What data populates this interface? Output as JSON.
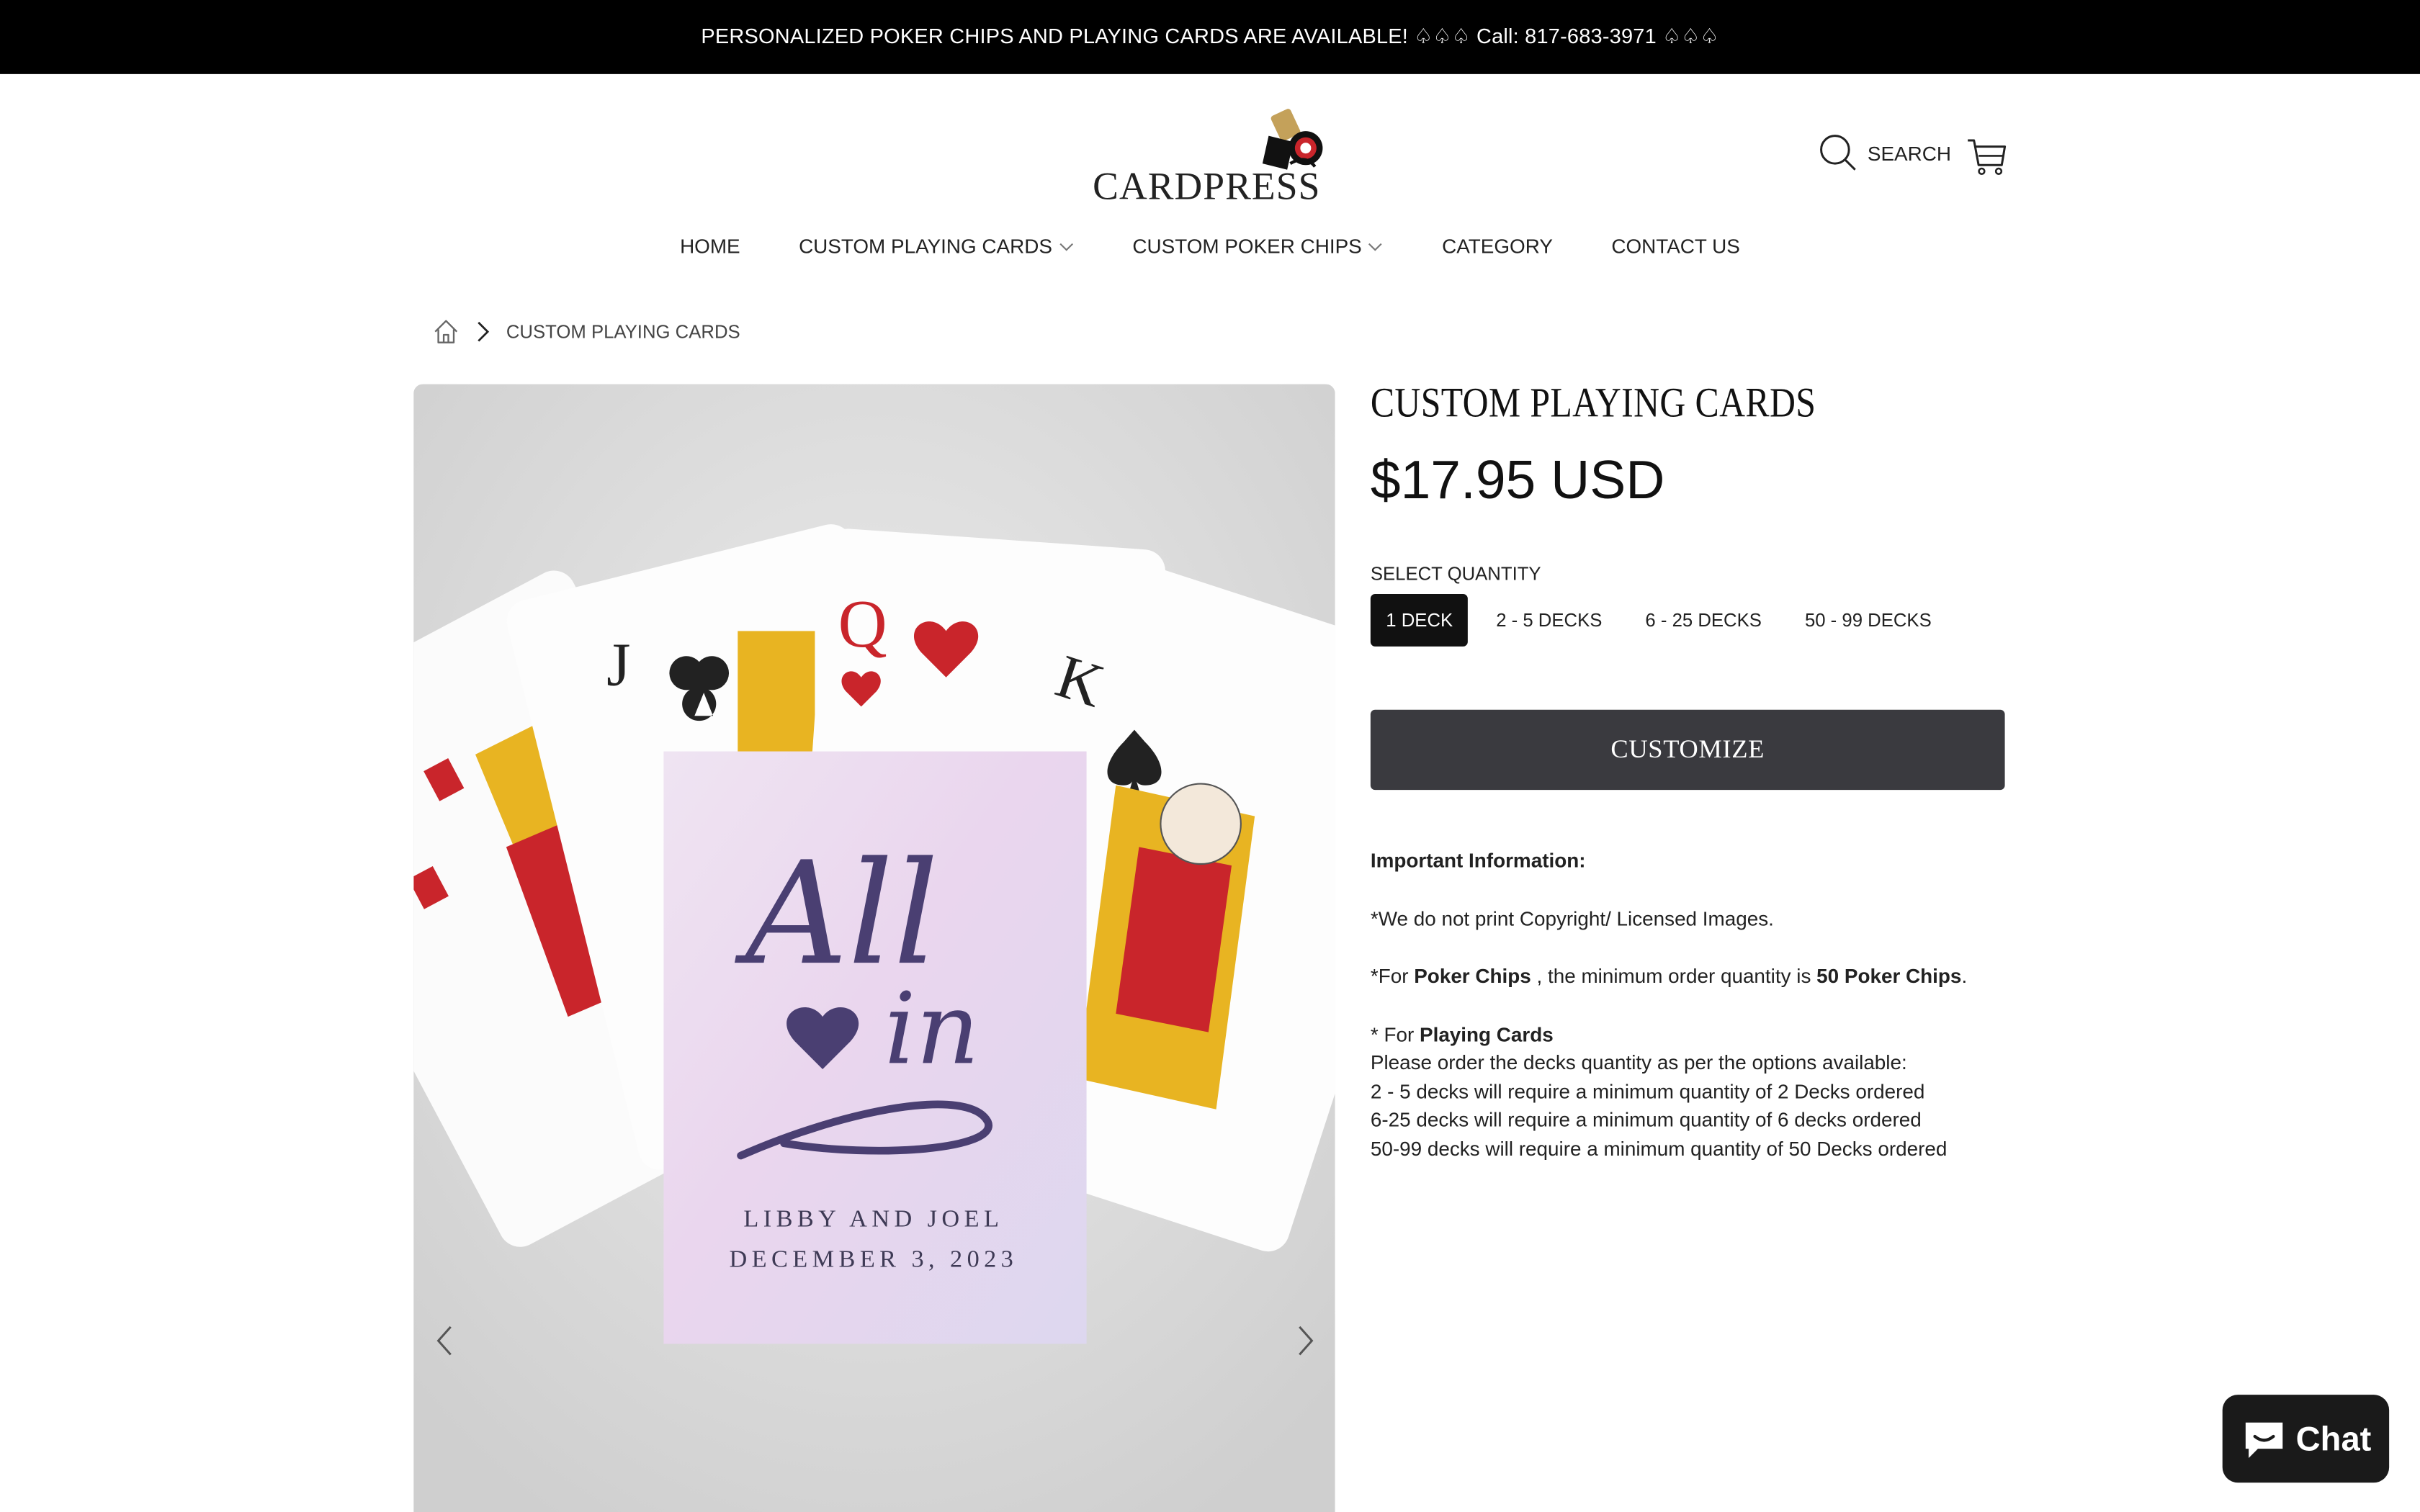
{
  "announcement": {
    "text": "PERSONALIZED POKER CHIPS AND PLAYING CARDS ARE AVAILABLE! ♤♤♤ Call: 817-683-3971 ♤♤♤"
  },
  "brand": {
    "name": "CARDPRESS"
  },
  "header": {
    "search_label": "SEARCH"
  },
  "nav": {
    "items": [
      {
        "label": "HOME"
      },
      {
        "label": "CUSTOM PLAYING CARDS"
      },
      {
        "label": "CUSTOM POKER CHIPS"
      },
      {
        "label": "CATEGORY"
      },
      {
        "label": "CONTACT US"
      }
    ]
  },
  "breadcrumb": {
    "current": "CUSTOM PLAYING CARDS"
  },
  "gallery": {
    "card_names": "LIBBY AND JOEL",
    "card_date": "DECEMBER 3, 2023",
    "card_script_1": "All",
    "card_script_2": "in"
  },
  "product": {
    "title": "CUSTOM PLAYING CARDS",
    "price": "$17.95 USD",
    "quantity_label": "SELECT QUANTITY",
    "quantity_options": [
      "1 DECK",
      "2 - 5 DECKS",
      "6 - 25 DECKS",
      "50 - 99 DECKS"
    ],
    "selected_quantity": "1 DECK",
    "customize_label": "CUSTOMIZE"
  },
  "info": {
    "heading": "Important Information:",
    "line_copyright": "*We do not print Copyright/ Licensed Images.",
    "chips_prefix": "*For ",
    "chips_bold": "Poker Chips",
    "chips_mid": " , the minimum order quantity is ",
    "chips_bold2": "50 Poker Chips",
    "chips_end": ".",
    "cards_prefix": "* For ",
    "cards_bold": "Playing Cards",
    "cards_line1": "Please order the decks quantity as per the options available:",
    "cards_line2": "2 - 5 decks will require a minimum quantity of 2 Decks ordered",
    "cards_line3": "6-25 decks will require a minimum quantity of 6 decks ordered",
    "cards_line4": "50-99 decks will require a minimum quantity of 50 Decks ordered"
  },
  "chat": {
    "label": "Chat"
  },
  "colors": {
    "announce_bg": "#000000",
    "button_bg": "#3a3a3f",
    "accent_purple": "#4a3f72",
    "card_red": "#c9252b"
  }
}
